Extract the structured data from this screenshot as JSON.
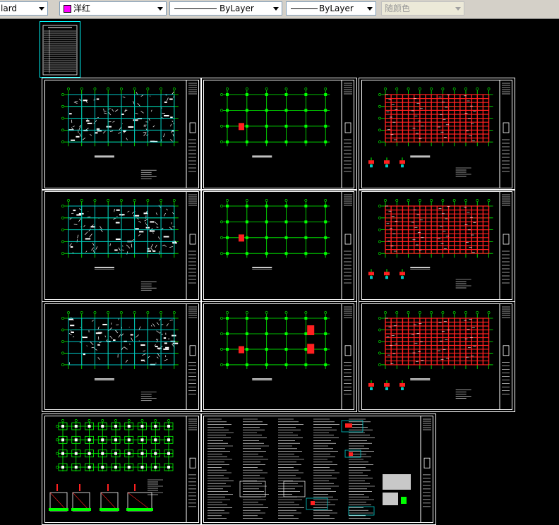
{
  "toolbar": {
    "text_style_value": "lard",
    "color_value": "洋红",
    "color_swatch": "#ff00ff",
    "linetype_value": "ByLayer",
    "lineweight_value": "ByLayer",
    "plot_style_value": "随颜色"
  },
  "colors": {
    "frame": "#ffffff",
    "grid": "#00ff00",
    "beam": "#ff2020",
    "slab": "#00c8c8",
    "selection": "#00ffff",
    "background": "#000000"
  },
  "icons": [
    "dropdown-arrow-icon"
  ]
}
